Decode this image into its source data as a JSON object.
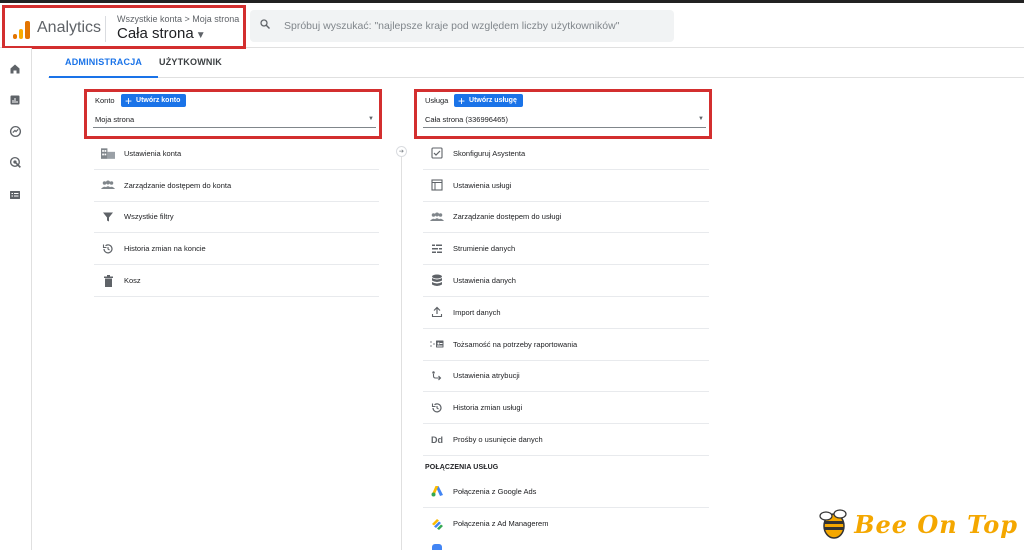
{
  "header": {
    "app_name": "Analytics",
    "breadcrumb": "Wszystkie konta > Moja strona",
    "property_name": "Cała strona",
    "search_placeholder": "Spróbuj wyszukać: \"najlepsze kraje pod względem liczby użytkowników\""
  },
  "leftnav": {
    "items": [
      "home-icon",
      "reports-icon",
      "explore-icon",
      "advertising-icon",
      "configure-icon"
    ]
  },
  "tabs": [
    {
      "label": "ADMINISTRACJA",
      "active": true
    },
    {
      "label": "UŻYTKOWNIK",
      "active": false
    }
  ],
  "account": {
    "label": "Konto",
    "create_label": "Utwórz konto",
    "selected": "Moja strona",
    "menu": [
      {
        "icon": "building-icon",
        "label": "Ustawienia konta"
      },
      {
        "icon": "people-icon",
        "label": "Zarządzanie dostępem do konta"
      },
      {
        "icon": "filter-icon",
        "label": "Wszystkie filtry"
      },
      {
        "icon": "history-icon",
        "label": "Historia zmian na koncie"
      },
      {
        "icon": "trash-icon",
        "label": "Kosz"
      }
    ]
  },
  "property": {
    "label": "Usługa",
    "create_label": "Utwórz usługę",
    "selected": "Cała strona (336996465)",
    "menu": [
      {
        "icon": "checkbox-icon",
        "label": "Skonfiguruj Asystenta"
      },
      {
        "icon": "layout-icon",
        "label": "Ustawienia usługi"
      },
      {
        "icon": "people-icon",
        "label": "Zarządzanie dostępem do usługi"
      },
      {
        "icon": "streams-icon",
        "label": "Strumienie danych"
      },
      {
        "icon": "database-icon",
        "label": "Ustawienia danych"
      },
      {
        "icon": "upload-icon",
        "label": "Import danych"
      },
      {
        "icon": "identity-icon",
        "label": "Tożsamość na potrzeby raportowania"
      },
      {
        "icon": "attribution-icon",
        "label": "Ustawienia atrybucji"
      },
      {
        "icon": "history-icon",
        "label": "Historia zmian usługi"
      },
      {
        "icon": "dd-icon",
        "label": "Prośby o usunięcie danych"
      }
    ],
    "connections_heading": "POŁĄCZENIA USŁUG",
    "connections": [
      {
        "icon": "google-ads-icon",
        "label": "Połączenia z Google Ads"
      },
      {
        "icon": "ad-manager-icon",
        "label": "Połączenia z Ad Managerem"
      }
    ]
  },
  "watermark": {
    "text": "Bee On Top"
  },
  "colors": {
    "accent": "#1a73e8",
    "highlight": "#d32f2f",
    "logo_orange": "#e37400",
    "watermark": "#f4a700"
  }
}
